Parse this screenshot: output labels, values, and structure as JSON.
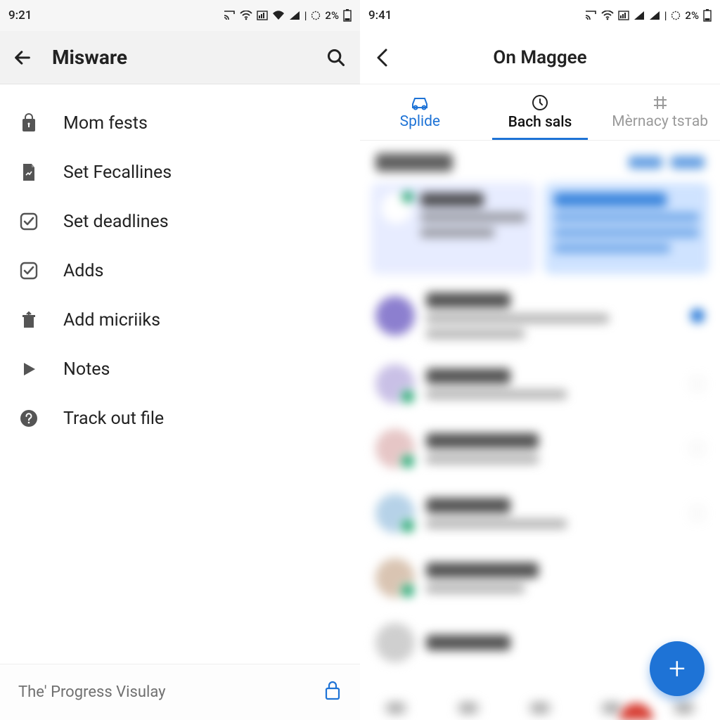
{
  "left": {
    "status": {
      "time": "9:21",
      "battery": "2%"
    },
    "header": {
      "title": "Misware"
    },
    "menu": [
      {
        "icon": "lock",
        "label": "Mom fests"
      },
      {
        "icon": "doc",
        "label": "Set Fecallines"
      },
      {
        "icon": "check",
        "label": "Set deadlines"
      },
      {
        "icon": "check",
        "label": "Adds"
      },
      {
        "icon": "upload",
        "label": "Add micriiks"
      },
      {
        "icon": "play",
        "label": "Notes"
      },
      {
        "icon": "help",
        "label": "Track out file"
      }
    ],
    "footer": {
      "label": "The' Progress Visulay"
    }
  },
  "right": {
    "status": {
      "time": "9:41",
      "battery": "2%"
    },
    "header": {
      "title": "On Maggee"
    },
    "tabs": [
      {
        "label": "Splide",
        "state": "active",
        "icon": "car"
      },
      {
        "label": "Bach sals",
        "state": "selected",
        "icon": "clock"
      },
      {
        "label": "Mèrnacy tsтab",
        "state": "muted",
        "icon": "grid"
      }
    ],
    "fab": {
      "label": "+"
    }
  },
  "colors": {
    "accent": "#1e73d6"
  }
}
